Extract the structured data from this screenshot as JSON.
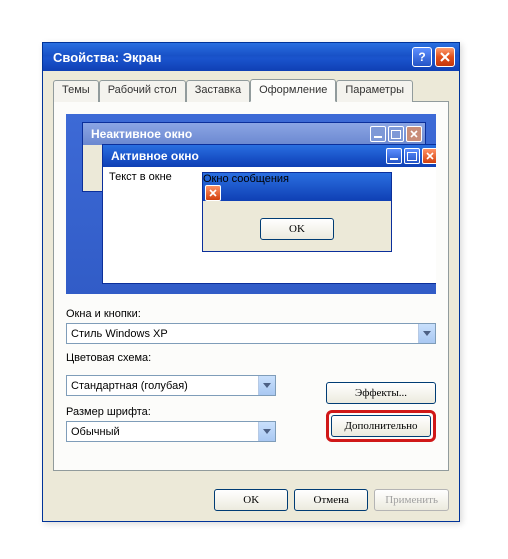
{
  "dialog": {
    "title": "Свойства: Экран"
  },
  "tabs": {
    "themes": "Темы",
    "desktop": "Рабочий стол",
    "screensaver": "Заставка",
    "appearance": "Оформление",
    "settings": "Параметры"
  },
  "preview": {
    "inactive_title": "Неактивное окно",
    "active_title": "Активное окно",
    "active_text": "Текст в окне",
    "msgbox_title": "Окно сообщения",
    "msgbox_ok": "OK"
  },
  "fields": {
    "style_label": "Окна и кнопки:",
    "style_value": "Стиль Windows XP",
    "color_label": "Цветовая схема:",
    "color_value": "Стандартная (голубая)",
    "font_label": "Размер шрифта:",
    "font_value": "Обычный"
  },
  "buttons": {
    "effects": "Эффекты...",
    "advanced": "Дополнительно",
    "ok": "OK",
    "cancel": "Отмена",
    "apply": "Применить"
  }
}
